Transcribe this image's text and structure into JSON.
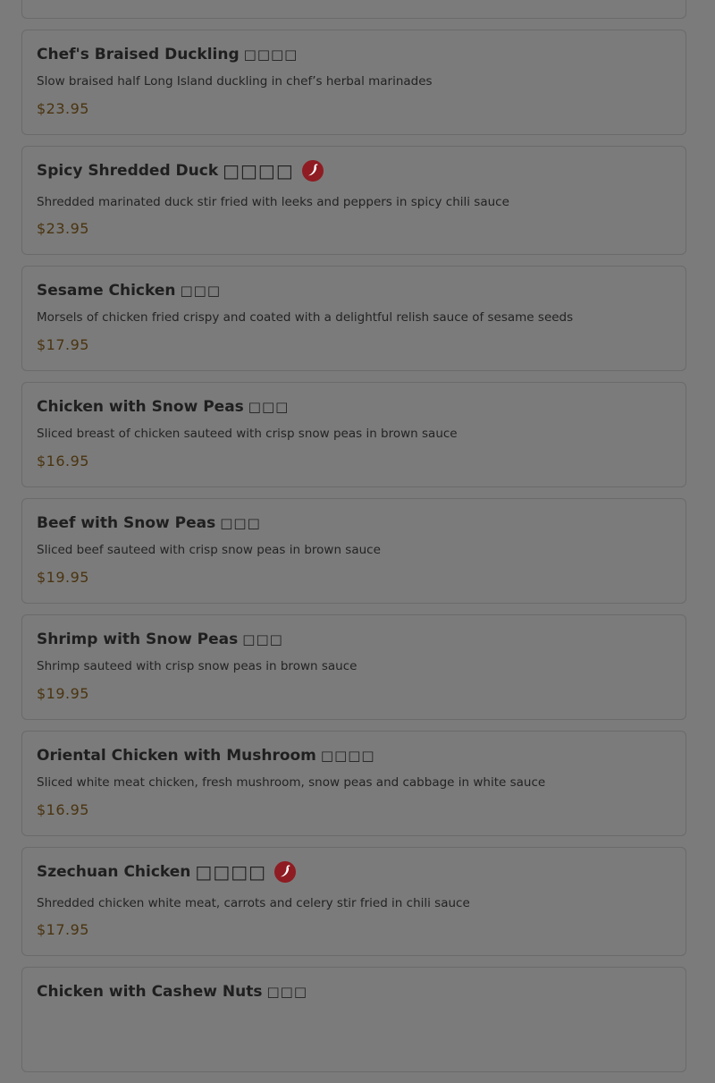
{
  "menu": {
    "items": [
      {
        "name": "",
        "chinese": "",
        "description": "",
        "price": ""
      },
      {
        "name": "Chef's Braised Duckling",
        "chinese": "□□□□",
        "description": "Slow braised half Long Island duckling in chef’s herbal marinades",
        "price": "$23.95"
      },
      {
        "name": "Spicy Shredded Duck",
        "chinese": "□□□□",
        "spicy_icon": "chili-pepper-icon",
        "description": "Shredded marinated duck stir fried with leeks and peppers in spicy chili sauce",
        "price": "$23.95"
      },
      {
        "name": "Sesame Chicken",
        "chinese": "□□□",
        "description": "Morsels of chicken fried crispy and coated with a delightful relish sauce of sesame seeds",
        "price": "$17.95"
      },
      {
        "name": "Chicken with Snow Peas",
        "chinese": "□□□",
        "description": "Sliced breast of chicken sauteed with crisp snow peas in brown sauce",
        "price": "$16.95"
      },
      {
        "name": "Beef with Snow Peas",
        "chinese": "□□□",
        "description": "Sliced beef sauteed with crisp snow peas in brown sauce",
        "price": "$19.95"
      },
      {
        "name": "Shrimp with Snow Peas",
        "chinese": "□□□",
        "description": "Shrimp sauteed with crisp snow peas in brown sauce",
        "price": "$19.95"
      },
      {
        "name": "Oriental Chicken with Mushroom",
        "chinese": "□□□□",
        "description": "Sliced white meat chicken, fresh mushroom, snow peas and cabbage in white sauce",
        "price": "$16.95"
      },
      {
        "name": "Szechuan Chicken",
        "chinese": "□□□□",
        "spicy_icon": "chili-pepper-icon",
        "description": "Shredded chicken white meat, carrots and celery stir fried in chili sauce",
        "price": "$17.95"
      },
      {
        "name": "Chicken with Cashew Nuts",
        "chinese": "□□□",
        "description": "",
        "price": ""
      }
    ]
  },
  "colors": {
    "overlay_background": "#7b7b7b",
    "card_border": "#6a6a6a",
    "price_text": "#4a3410",
    "chili_circle": "#8e1c22"
  }
}
